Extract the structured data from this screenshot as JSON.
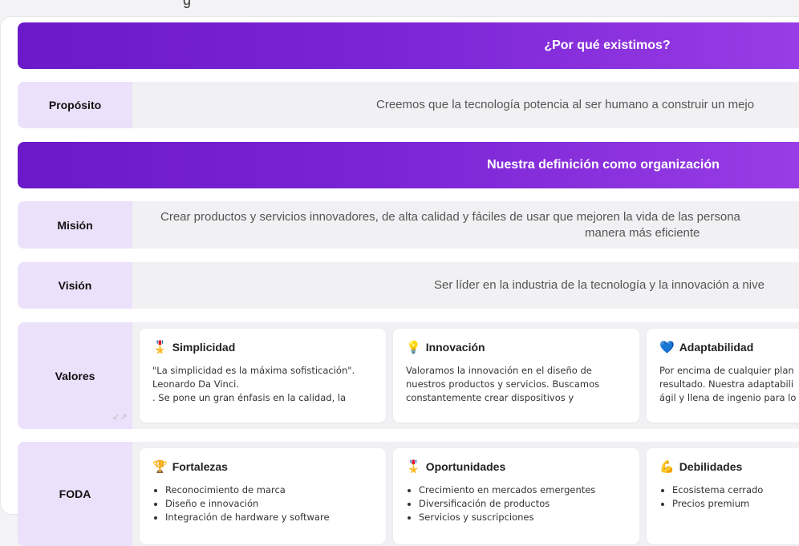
{
  "top_partial_text": "g",
  "why_section": {
    "heading": "¿Por qué existimos?"
  },
  "purpose": {
    "label": "Propósito",
    "text": "Creemos que la tecnología potencia al ser humano a construir un mejo"
  },
  "definition_section": {
    "heading": "Nuestra definición como organización"
  },
  "mission": {
    "label": "Misión",
    "line1": "Crear productos y servicios innovadores, de alta calidad y fáciles de usar que mejoren la vida de las persona",
    "line2": "manera más eficiente"
  },
  "vision": {
    "label": "Visión",
    "text": "Ser líder en la industria de la tecnología y la innovación a nive"
  },
  "values": {
    "label": "Valores",
    "resize_icon": "↙↗",
    "cards": [
      {
        "icon": "🎖️",
        "icon_name": "medal-icon",
        "title": "Simplicidad",
        "lines": [
          "\"La simplicidad es la máxima sofisticación\".",
          "Leonardo Da Vinci.",
          ". Se pone un gran énfasis en la calidad, la"
        ]
      },
      {
        "icon": "💡",
        "icon_name": "lightbulb-icon",
        "title": "Innovación",
        "lines": [
          "Valoramos la innovación en el diseño de",
          "nuestros productos y servicios. Buscamos",
          "constantemente crear dispositivos y"
        ]
      },
      {
        "icon": "💙",
        "icon_name": "blue-heart-icon",
        "title": "Adaptabilidad",
        "lines": [
          "Por encima de cualquier plan",
          "resultado. Nuestra adaptabili",
          "ágil y llena de ingenio para lo"
        ]
      }
    ]
  },
  "swot": {
    "label": "FODA",
    "cards": [
      {
        "icon": "🏆",
        "icon_name": "trophy-icon",
        "title": "Fortalezas",
        "items": [
          "Reconocimiento de marca",
          "Diseño e innovación",
          "Integración de hardware y software"
        ]
      },
      {
        "icon": "🎖️",
        "icon_name": "medal-icon",
        "title": "Oportunidades",
        "items": [
          "Crecimiento en mercados emergentes",
          "Diversificación de productos",
          "Servicios y suscripciones"
        ]
      },
      {
        "icon": "💪",
        "icon_name": "flexed-biceps-icon",
        "title": "Debilidades",
        "items": [
          "Ecosistema cerrado",
          "Precios premium"
        ]
      }
    ]
  },
  "colors": {
    "band_start": "#6b19c9",
    "band_end": "#9a3ee6",
    "label_bg": "#ebe1fb",
    "row_bg": "#f1f1f3"
  }
}
